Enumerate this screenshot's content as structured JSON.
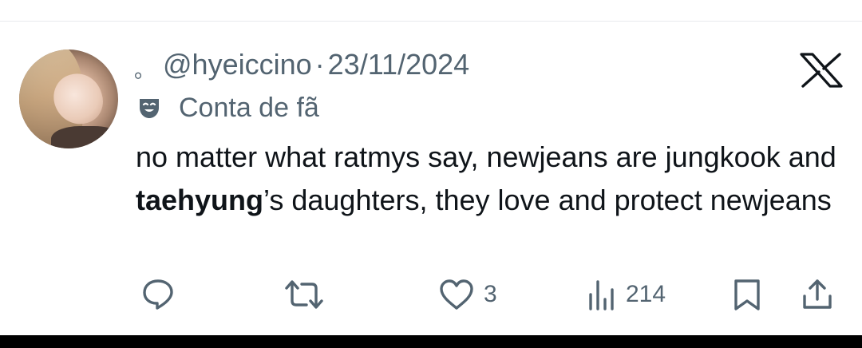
{
  "tweet": {
    "prefix_mark": "。",
    "handle": "@hyeiccino",
    "separator": "·",
    "date": "23/11/2024",
    "label": "Conta de fã",
    "text_part1": "no matter what ratmys say, newjeans are jungkook and ",
    "text_bold": "taehyung",
    "text_part2": "’s daughters, they love and protect newjeans"
  },
  "actions": {
    "reply_icon": "reply-icon",
    "retweet_icon": "retweet-icon",
    "like_icon": "heart-icon",
    "like_count": "3",
    "views_icon": "views-icon",
    "views_count": "214",
    "bookmark_icon": "bookmark-icon",
    "share_icon": "share-icon"
  },
  "brand": {
    "logo_icon": "x-logo-icon",
    "text_color": "#0f1419",
    "secondary_color": "#536471"
  }
}
